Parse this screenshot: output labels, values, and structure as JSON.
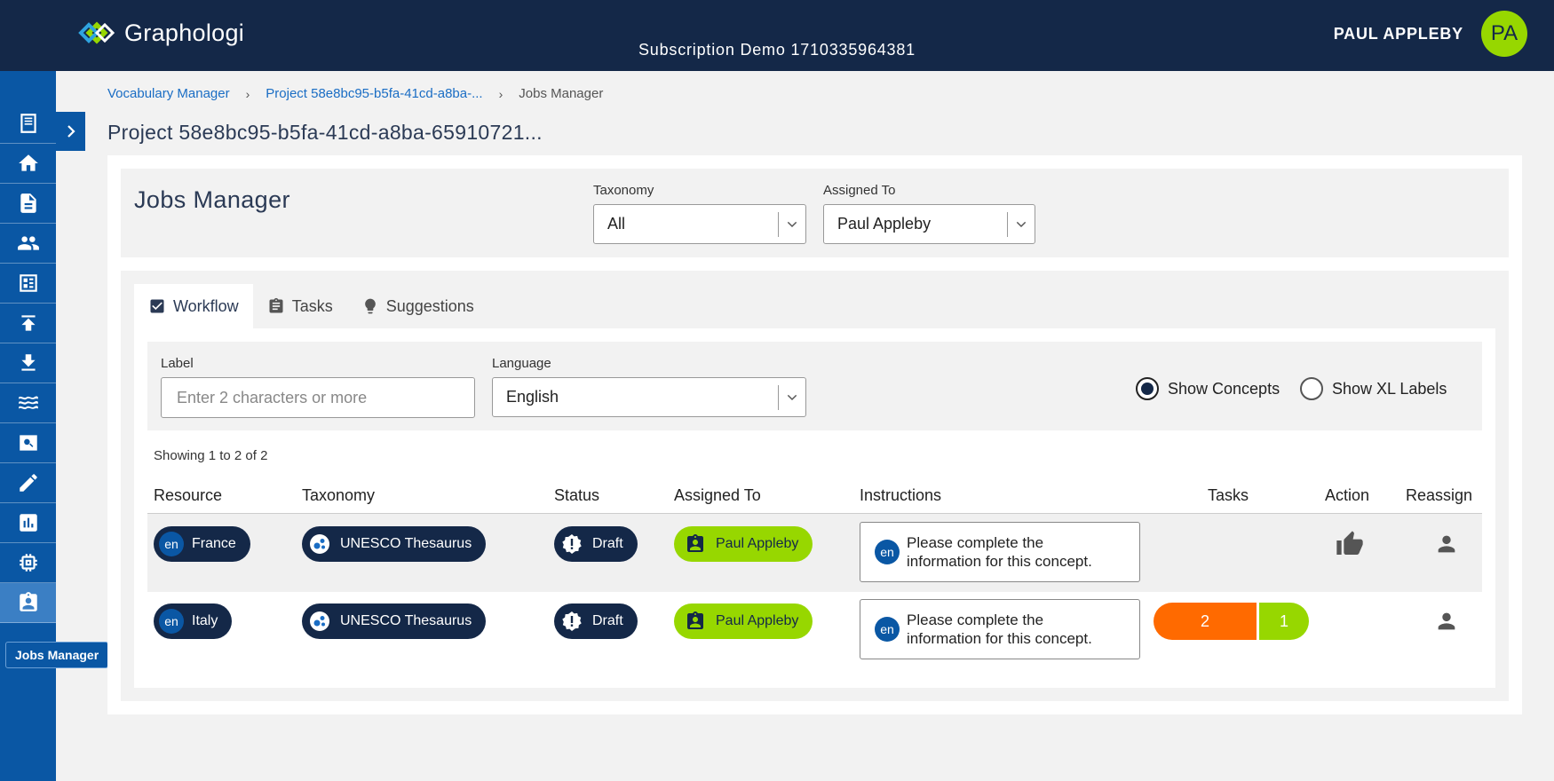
{
  "app": {
    "logo_text": "Graphologi",
    "subscription": "Subscription Demo 1710335964381",
    "user_name": "PAUL APPLEBY",
    "avatar_initials": "PA",
    "brand_color": "#142848",
    "accent_color": "#97d700"
  },
  "sidebar": {
    "items": [
      {
        "icon": "document-icon"
      },
      {
        "icon": "home-icon"
      },
      {
        "icon": "file-icon"
      },
      {
        "icon": "people-icon"
      },
      {
        "icon": "dashboard-icon"
      },
      {
        "icon": "upload-icon"
      },
      {
        "icon": "download-icon"
      },
      {
        "icon": "waves-icon"
      },
      {
        "icon": "search-icon"
      },
      {
        "icon": "edit-icon"
      },
      {
        "icon": "chart-icon"
      },
      {
        "icon": "chip-icon"
      },
      {
        "icon": "assignment-icon"
      }
    ],
    "active_tooltip": "Jobs Manager"
  },
  "breadcrumb": {
    "items": [
      "Vocabulary Manager",
      "Project 58e8bc95-b5fa-41cd-a8ba-...",
      "Jobs Manager"
    ]
  },
  "page_title": "Project 58e8bc95-b5fa-41cd-a8ba-65910721...",
  "jobs": {
    "title": "Jobs Manager",
    "taxonomy_label": "Taxonomy",
    "taxonomy_value": "All",
    "assigned_label": "Assigned To",
    "assigned_value": "Paul Appleby"
  },
  "tabs": [
    {
      "label": "Workflow",
      "icon": "checkbox-icon",
      "active": true
    },
    {
      "label": "Tasks",
      "icon": "clipboard-icon",
      "active": false
    },
    {
      "label": "Suggestions",
      "icon": "lightbulb-icon",
      "active": false
    }
  ],
  "filters": {
    "label_label": "Label",
    "label_placeholder": "Enter 2 characters or more",
    "language_label": "Language",
    "language_value": "English",
    "show_concepts": "Show Concepts",
    "show_xl_labels": "Show XL Labels",
    "selected": "Show Concepts"
  },
  "table": {
    "showing": "Showing 1 to 2 of 2",
    "headers": [
      "Resource",
      "Taxonomy",
      "Status",
      "Assigned To",
      "Instructions",
      "Tasks",
      "Action",
      "Reassign"
    ],
    "rows": [
      {
        "lang": "en",
        "resource": "France",
        "taxonomy": "UNESCO Thesaurus",
        "status": "Draft",
        "assigned": "Paul Appleby",
        "instr_lang": "en",
        "instr_line1": "Please complete the",
        "instr_line2": "information for this concept.",
        "tasks": null
      },
      {
        "lang": "en",
        "resource": "Italy",
        "taxonomy": "UNESCO Thesaurus",
        "status": "Draft",
        "assigned": "Paul Appleby",
        "instr_lang": "en",
        "instr_line1": "Please complete the",
        "instr_line2": "information for this concept.",
        "tasks": {
          "open": "2",
          "done": "1"
        }
      }
    ]
  }
}
